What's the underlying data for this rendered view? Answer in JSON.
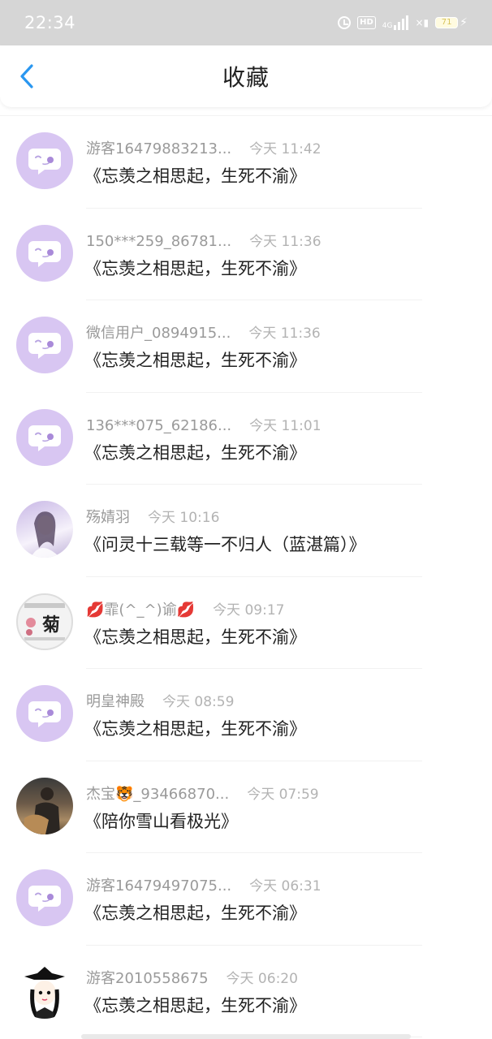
{
  "status_bar": {
    "time": "22:34",
    "hd_label": "HD",
    "net_label": "4G",
    "battery": "71",
    "icons": [
      "alarm-icon",
      "hd-icon",
      "signal-icon",
      "no-signal-icon",
      "battery-icon",
      "charging-icon"
    ]
  },
  "header": {
    "title": "收藏",
    "back_icon": "chevron-left-icon",
    "accent_color": "#2a97f0"
  },
  "items": [
    {
      "user": "游客16479883213...",
      "time": "今天 11:42",
      "title": "《忘羡之相思起，生死不渝》",
      "avatar": "default"
    },
    {
      "user": "150***259_86781...",
      "time": "今天 11:36",
      "title": "《忘羡之相思起，生死不渝》",
      "avatar": "default"
    },
    {
      "user": "微信用户_0894915...",
      "time": "今天 11:36",
      "title": "《忘羡之相思起，生死不渝》",
      "avatar": "default"
    },
    {
      "user": "136***075_62186...",
      "time": "今天 11:01",
      "title": "《忘羡之相思起，生死不渝》",
      "avatar": "default"
    },
    {
      "user": "殇婧羽",
      "time": "今天 10:16",
      "title": "《问灵十三载等一不归人（蓝湛篇）》",
      "avatar": "photo-girl"
    },
    {
      "user_prefix": "💋",
      "user": "霏(^_^)谕",
      "user_suffix": "💋",
      "time": "今天 09:17",
      "title": "《忘羡之相思起，生死不渝》",
      "avatar": "photo-badge",
      "avatar_text": "菊"
    },
    {
      "user": "明皇神殿",
      "time": "今天 08:59",
      "title": "《忘羡之相思起，生死不渝》",
      "avatar": "default"
    },
    {
      "user": "杰宝🐯_93466870...",
      "time": "今天 07:59",
      "title": "《陪你雪山看极光》",
      "avatar": "photo-man"
    },
    {
      "user": "游客16479497075...",
      "time": "今天 06:31",
      "title": "《忘羡之相思起，生死不渝》",
      "avatar": "default"
    },
    {
      "user": "游客2010558675",
      "time": "今天 06:20",
      "title": "《忘羡之相思起，生死不渝》",
      "avatar": "photo-cartoon"
    }
  ],
  "colors": {
    "default_avatar_bg": "#d8c6f2",
    "default_avatar_bubble": "#ffffff",
    "default_avatar_dot": "#a98ad9"
  }
}
